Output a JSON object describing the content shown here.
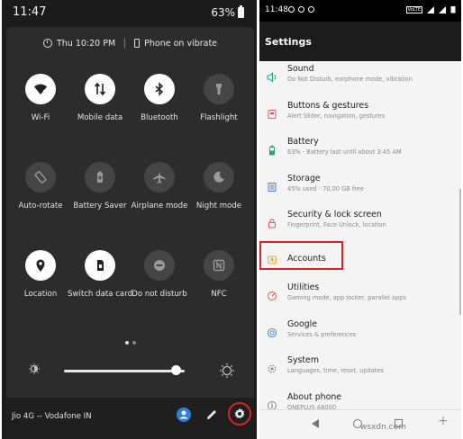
{
  "quick_settings": {
    "status": {
      "time": "11:47",
      "battery": "63%"
    },
    "info_bar": {
      "alarm": "Thu 10:20 PM",
      "ring_mode": "Phone on vibrate"
    },
    "tiles": [
      {
        "label": "Wi-Fi",
        "icon": "wifi-icon",
        "on": true
      },
      {
        "label": "Mobile data",
        "icon": "mobile-data-icon",
        "on": true
      },
      {
        "label": "Bluetooth",
        "icon": "bluetooth-icon",
        "on": true
      },
      {
        "label": "Flashlight",
        "icon": "flashlight-icon",
        "on": false
      },
      {
        "label": "Auto-rotate",
        "icon": "auto-rotate-icon",
        "on": false
      },
      {
        "label": "Battery Saver",
        "icon": "battery-saver-icon",
        "on": false
      },
      {
        "label": "Airplane mode",
        "icon": "airplane-icon",
        "on": false
      },
      {
        "label": "Night mode",
        "icon": "night-mode-icon",
        "on": false
      },
      {
        "label": "Location",
        "icon": "location-icon",
        "on": true
      },
      {
        "label": "Switch data card",
        "icon": "sim-card-icon",
        "on": true
      },
      {
        "label": "Do not disturb",
        "icon": "do-not-disturb-icon",
        "on": false
      },
      {
        "label": "NFC",
        "icon": "nfc-icon",
        "on": false
      }
    ],
    "brightness_fraction": 0.93,
    "carrier": "Jio 4G -- Vodafone IN"
  },
  "settings": {
    "status": {
      "time": "11:48",
      "network_tag": "VoLTE"
    },
    "title": "Settings",
    "items": [
      {
        "title": "Sound",
        "subtitle": "Do Not Disturb, earphone mode, vibration",
        "icon": "sound-icon",
        "color": "#1aa79b"
      },
      {
        "title": "Buttons & gestures",
        "subtitle": "Alert Slider, navigation, gestures",
        "icon": "buttons-icon",
        "color": "#e8554e"
      },
      {
        "title": "Battery",
        "subtitle": "63% - Battery last until about 3:45 AM",
        "icon": "battery-icon",
        "color": "#2aa36b"
      },
      {
        "title": "Storage",
        "subtitle": "45% used - 70.00 GB free",
        "icon": "storage-icon",
        "color": "#5a7fbf"
      },
      {
        "title": "Security & lock screen",
        "subtitle": "Fingerprint, Face Unlock, location",
        "icon": "lock-icon",
        "color": "#e8554e"
      },
      {
        "title": "Accounts",
        "subtitle": "",
        "icon": "accounts-icon",
        "color": "#e7a93a"
      },
      {
        "title": "Utilities",
        "subtitle": "Gaming mode, app locker, parallel apps",
        "icon": "utilities-icon",
        "color": "#e8554e"
      },
      {
        "title": "Google",
        "subtitle": "Services & preferences",
        "icon": "google-icon",
        "color": "#4a8ee8"
      },
      {
        "title": "System",
        "subtitle": "Languages, time, reset, updates",
        "icon": "system-icon",
        "color": "#8a8a8a"
      },
      {
        "title": "About phone",
        "subtitle": "ONEPLUS A6000",
        "icon": "info-icon",
        "color": "#8a8a8a"
      }
    ]
  },
  "watermark": "wsxdn.com"
}
